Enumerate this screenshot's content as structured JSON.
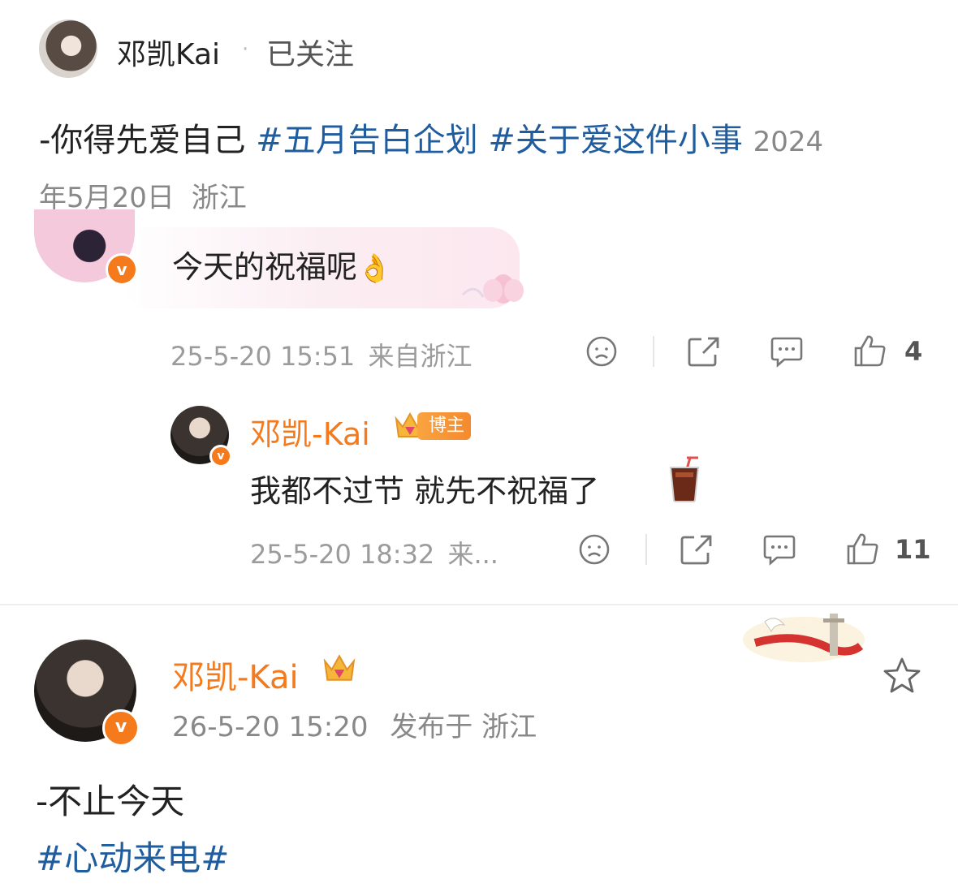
{
  "header": {
    "author_name": "邓凯Kai",
    "separator": "·",
    "follow_status": "已关注"
  },
  "post": {
    "text": "-你得先爱自己",
    "topics": [
      "#五月告白企划",
      "#关于爱这件小事"
    ],
    "date_line1": "2024",
    "date_line2": "年5月20日",
    "location": "浙江"
  },
  "comment": {
    "text": "今天的祝福呢",
    "time": "25-5-20 15:51",
    "source": "来自浙江",
    "likes": "4"
  },
  "reply": {
    "author": "邓凯-Kai",
    "badge": "博主",
    "text": "我都不过节 就先不祝福了",
    "time": "25-5-20 18:32",
    "source": "来...",
    "likes": "11"
  },
  "post2": {
    "author": "邓凯-Kai",
    "time": "26-5-20 15:20",
    "published": "发布于 浙江",
    "text": "-不止今天",
    "topic": "#心动来电#"
  },
  "colors": {
    "accent_orange": "#f47a1c",
    "topic_blue": "#1f5d9e",
    "meta_gray": "#9b9b9b"
  }
}
